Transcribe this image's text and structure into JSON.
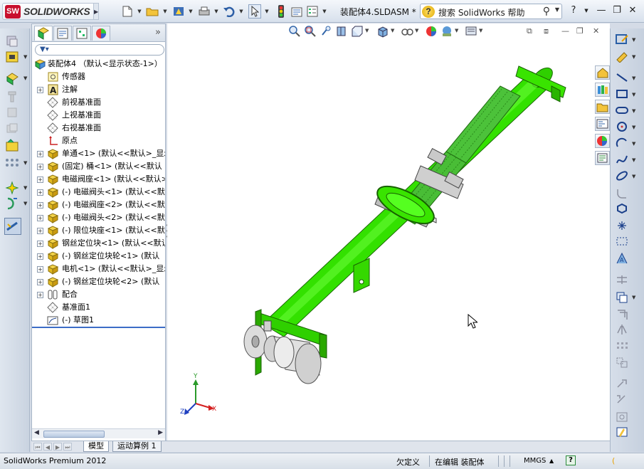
{
  "app": {
    "brand": "SOLIDWORKS",
    "brand_mark": "SW",
    "document_title": "装配体4.SLDASM *",
    "help_search_placeholder": "搜索 SolidWorks 帮助",
    "help_label": "?"
  },
  "feature_tree": {
    "root_label": "装配体4  （默认<显示状态-1>）",
    "items": [
      {
        "label": "传感器",
        "icon": "sensor-icon",
        "expandable": false
      },
      {
        "label": "注解",
        "icon": "annotation-icon",
        "expandable": true
      },
      {
        "label": "前视基准面",
        "icon": "plane-icon",
        "expandable": false
      },
      {
        "label": "上视基准面",
        "icon": "plane-icon",
        "expandable": false
      },
      {
        "label": "右视基准面",
        "icon": "plane-icon",
        "expandable": false
      },
      {
        "label": "原点",
        "icon": "origin-icon",
        "expandable": false
      },
      {
        "label": "单通<1> (默认<<默认>_显示",
        "icon": "part-icon",
        "expandable": true
      },
      {
        "label": "(固定) 桶<1> (默认<<默认",
        "icon": "part-icon",
        "expandable": true
      },
      {
        "label": "电磁阀座<1> (默认<<默认>",
        "icon": "part-icon",
        "expandable": true
      },
      {
        "label": "(-) 电磁阀头<1> (默认<<默",
        "icon": "part-icon",
        "expandable": true
      },
      {
        "label": "(-) 电磁阀座<2> (默认<<默",
        "icon": "part-icon",
        "expandable": true
      },
      {
        "label": "(-) 电磁阀头<2> (默认<<默",
        "icon": "part-icon",
        "expandable": true
      },
      {
        "label": "(-) 限位块座<1> (默认<<默",
        "icon": "part-icon",
        "expandable": true
      },
      {
        "label": "钢丝定位块<1> (默认<<默认",
        "icon": "part-icon",
        "expandable": true
      },
      {
        "label": "(-) 钢丝定位块轮<1> (默认",
        "icon": "part-icon",
        "expandable": true
      },
      {
        "label": "电机<1> (默认<<默认>_显示",
        "icon": "part-icon",
        "expandable": true
      },
      {
        "label": "(-) 钢丝定位块轮<2> (默认",
        "icon": "part-icon",
        "expandable": true
      },
      {
        "label": "配合",
        "icon": "mates-icon",
        "expandable": true
      },
      {
        "label": "基准面1",
        "icon": "plane-icon",
        "expandable": false
      },
      {
        "label": "(-) 草图1",
        "icon": "sketch-icon",
        "expandable": false
      }
    ]
  },
  "bottom_tabs": [
    "模型",
    "运动算例 1"
  ],
  "status_bar": {
    "product": "SolidWorks Premium 2012",
    "definition": "欠定义",
    "editing": "在编辑 装配体",
    "units": "MMGS",
    "units_arrow": "▲",
    "help_icon": "?"
  },
  "triad": {
    "x": "X",
    "y": "Y",
    "z": "Z"
  },
  "colors": {
    "model_green": "#33e100",
    "model_dark_green": "#1f8a00",
    "motor_grey": "#d9d9d9",
    "selection_blue": "#3c6cc7"
  }
}
